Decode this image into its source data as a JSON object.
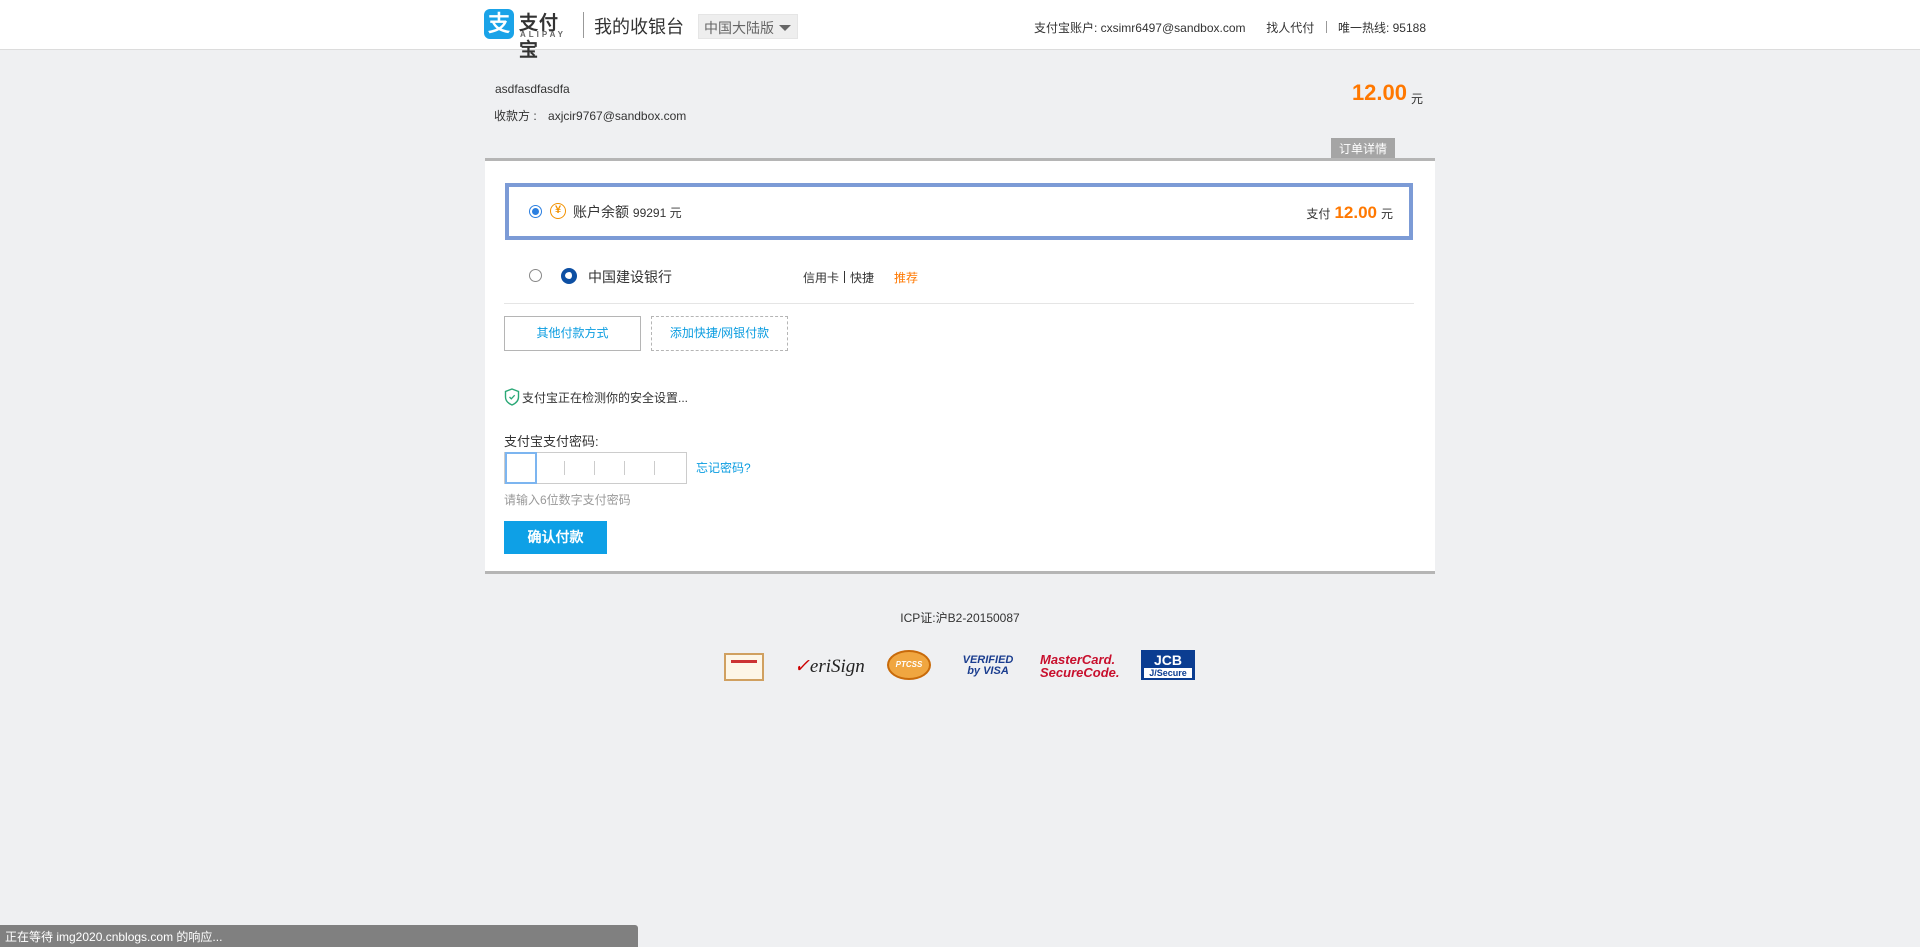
{
  "header": {
    "logo_mark": "支",
    "logo_text": "支付宝",
    "logo_sub": "ALIPAY",
    "title": "我的收银台",
    "region": "中国大陆版",
    "account_label": "支付宝账户:",
    "account_value": "cxsimr6497@sandbox.com",
    "find_pay_link": "找人代付",
    "hotline_label": "唯一热线:",
    "hotline_value": "95188"
  },
  "order": {
    "name": "asdfasdfasdfa",
    "payee_label": "收款方 :",
    "payee_value": "axjcir9767@sandbox.com",
    "amount": "12.00",
    "amount_unit": "元",
    "detail_tab": "订单详情"
  },
  "payment": {
    "balance": {
      "label": "账户余额",
      "amount": "99291 元",
      "pay_prefix": "支付",
      "pay_amount": "12.00",
      "pay_unit": "元",
      "icon": "yuan-coin-icon",
      "selected": true
    },
    "bank": {
      "label": "中国建设银行",
      "tag_credit": "信用卡",
      "tag_quick": "快捷",
      "recommend": "推荐",
      "icon": "ccb-bank-icon",
      "selected": false
    },
    "other_methods_button": "其他付款方式",
    "add_method_button": "添加快捷/网银付款"
  },
  "security": {
    "checking_text": "支付宝正在检测你的安全设置...",
    "password_label": "支付宝支付密码:",
    "forgot_link": "忘记密码?",
    "password_hint": "请输入6位数字支付密码",
    "confirm_button": "确认付款"
  },
  "footer": {
    "icp": "ICP证:沪B2-20150087",
    "badges": {
      "verisign": "eriSign",
      "ptc": "PTCSS",
      "visa_line1": "VERIFIED",
      "visa_line2": "by VISA",
      "mc_line1": "MasterCard.",
      "mc_line2": "SecureCode.",
      "jcb_line1": "JCB",
      "jcb_line2": "J/Secure"
    }
  },
  "status_bar": "正在等待 img2020.cnblogs.com 的响应...",
  "colors": {
    "accent_blue": "#0ea0e6",
    "amount_orange": "#ff7800",
    "selected_border": "#7c9bd6",
    "background": "#eff0f2"
  }
}
